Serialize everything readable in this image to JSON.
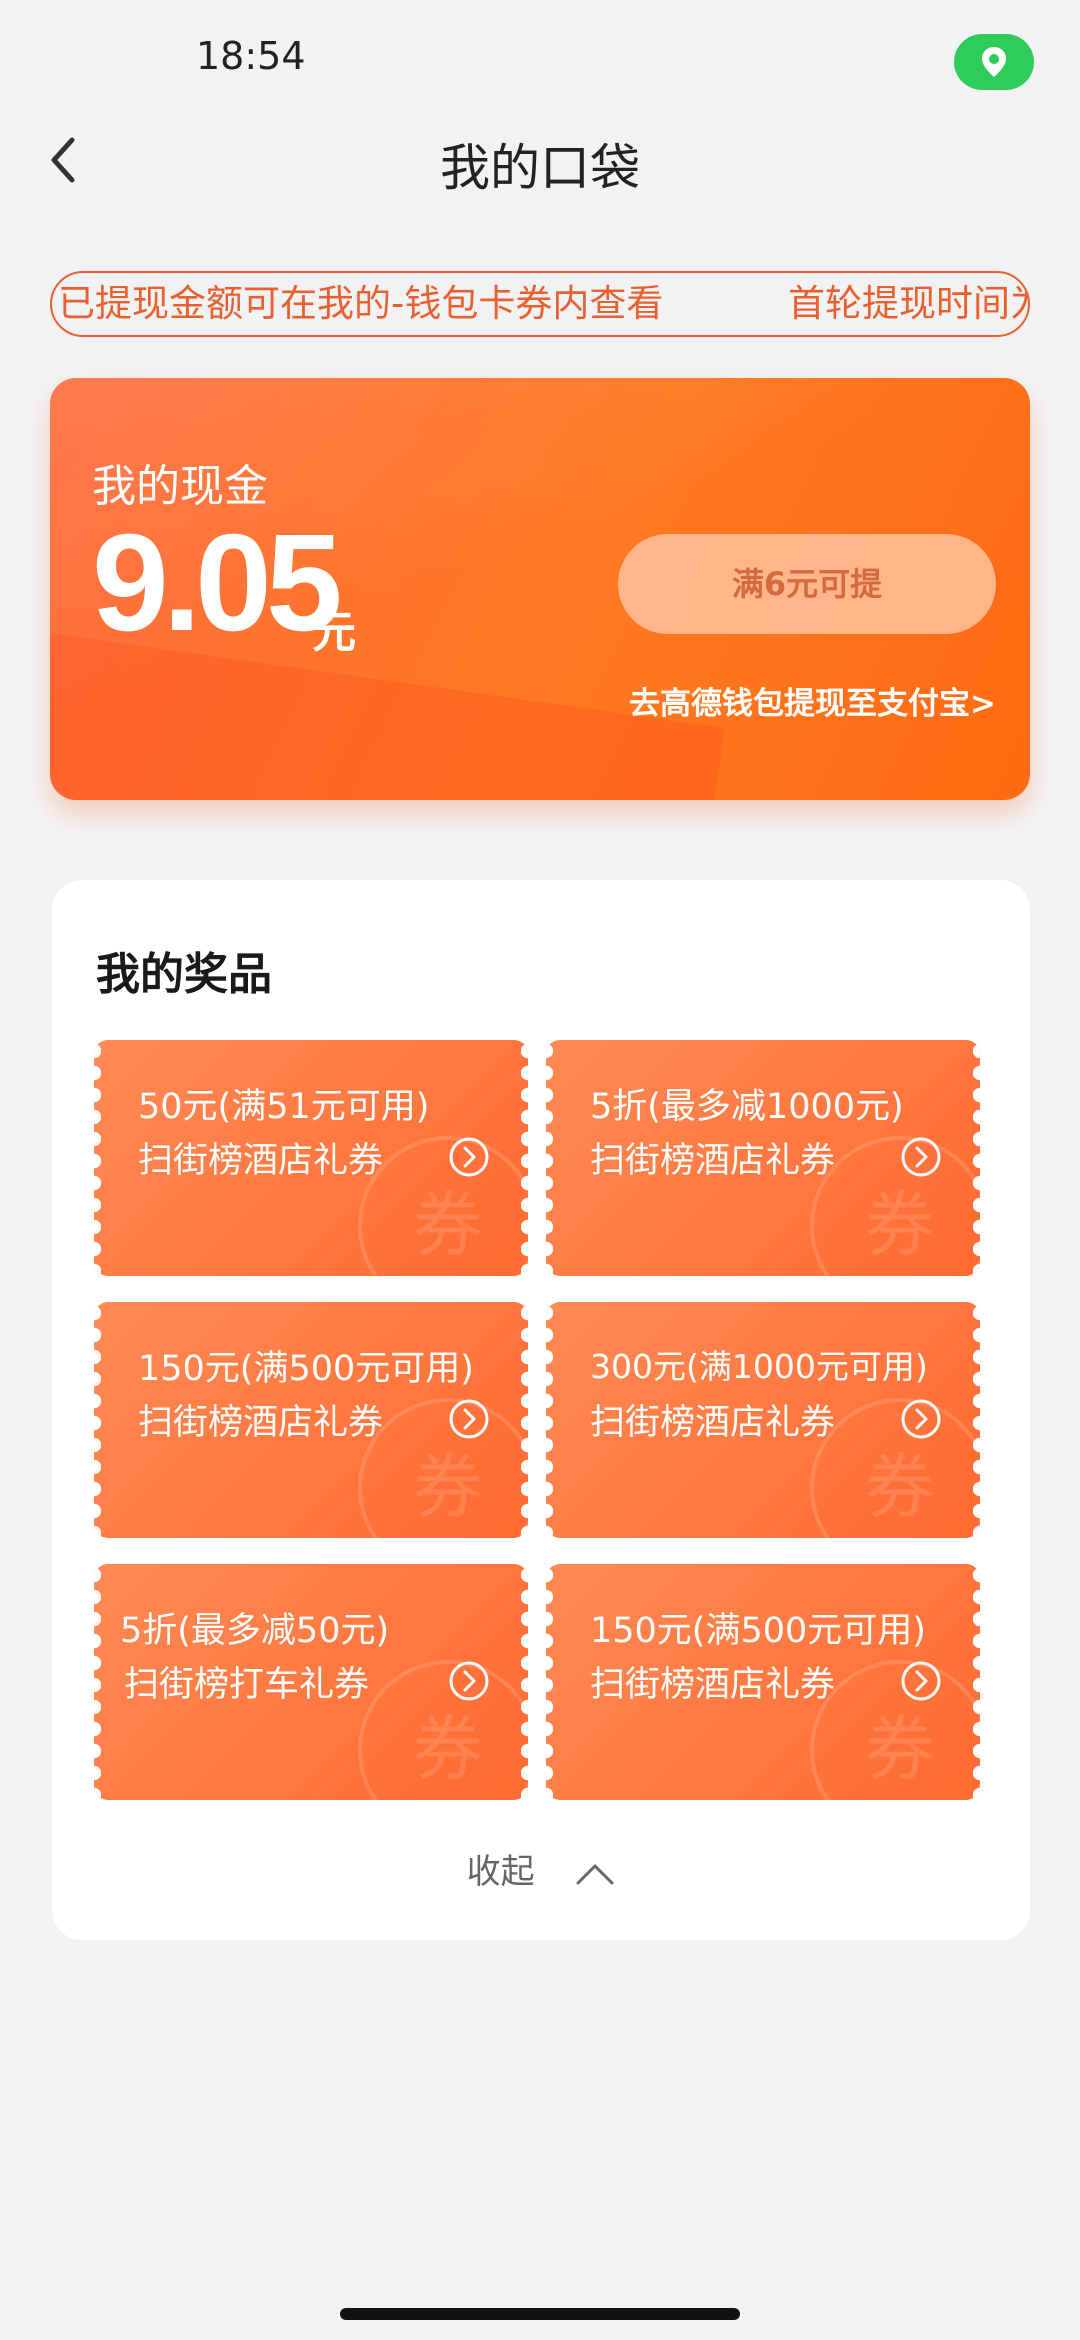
{
  "status_bar": {
    "time": "18:54"
  },
  "header": {
    "title": "我的口袋"
  },
  "marquee": {
    "text1": "已提现金额可在我的-钱包卡券内查看",
    "text2": "首轮提现时间为"
  },
  "cash": {
    "label": "我的现金",
    "amount": "9.05",
    "unit": "元",
    "withdraw_button": "满6元可提",
    "alipay_link": "去高德钱包提现至支付宝>"
  },
  "prizes": {
    "title": "我的奖品",
    "coupons": [
      {
        "line1": "50元(满51元可用)",
        "line2": "扫街榜酒店礼券"
      },
      {
        "line1": "5折(最多减1000元)",
        "line2": "扫街榜酒店礼券"
      },
      {
        "line1": "150元(满500元可用)",
        "line2": "扫街榜酒店礼券"
      },
      {
        "line1": "300元(满1000元可用)",
        "line2": "扫街榜酒店礼券"
      },
      {
        "line1": "5折(最多减50元)",
        "line2": "扫街榜打车礼券"
      },
      {
        "line1": "150元(满500元可用)",
        "line2": "扫街榜酒店礼券"
      }
    ],
    "watermark": "券",
    "collapse_label": "收起"
  },
  "colors": {
    "accent": "#ff6a30",
    "status_green": "#2ecc5a"
  }
}
